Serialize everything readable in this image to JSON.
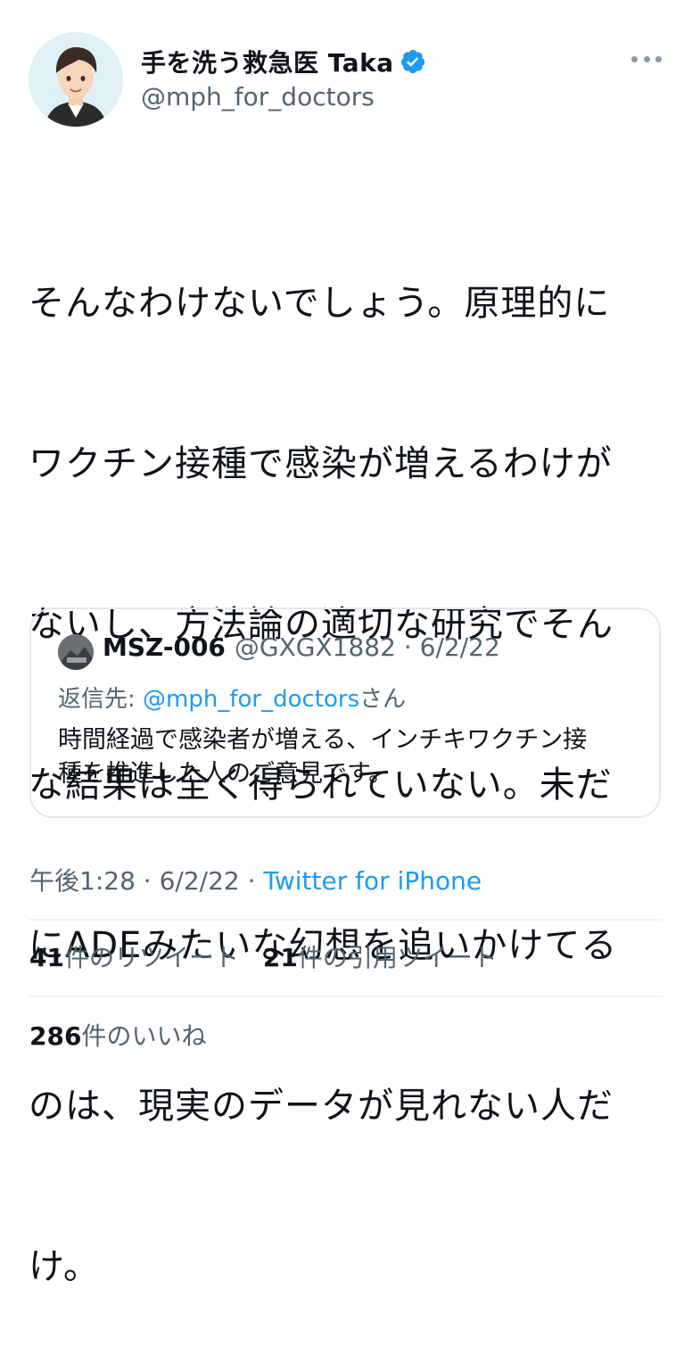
{
  "author": {
    "display_name": "手を洗う救急医 Taka",
    "handle": "@mph_for_doctors",
    "verified_icon": "verified-badge-icon"
  },
  "tweet": {
    "lines": [
      "そんなわけないでしょう。原理的に",
      "ワクチン接種で感染が増えるわけが",
      "ないし、方法論の適切な研究でそん",
      "な結果は全く得られていない。未だ",
      "にADEみたいな幻想を追いかけてる",
      "のは、現実のデータが見れない人だ",
      "け。"
    ]
  },
  "quote": {
    "name": "MSZ-006",
    "handle_date": "@GXGX1882 · 6/2/22",
    "reply_prefix": "返信先: ",
    "reply_mention": "@mph_for_doctors",
    "reply_suffix": "さん",
    "text": "時間経過で感染者が増える、インチキワクチン接\n種を推進した人のご意見です。"
  },
  "meta": {
    "time_date": "午後1:28 · 6/2/22 · ",
    "source": "Twitter for iPhone"
  },
  "stats": {
    "retweets_count": "41",
    "retweets_label": "件のリツイート",
    "quotes_count": "21",
    "quotes_label": "件の引用ツイート",
    "likes_count": "286",
    "likes_label": "件のいいね"
  },
  "colors": {
    "accent": "#1d9bf0",
    "secondary_text": "#536471",
    "avatar_bg": "#dff1f7"
  }
}
